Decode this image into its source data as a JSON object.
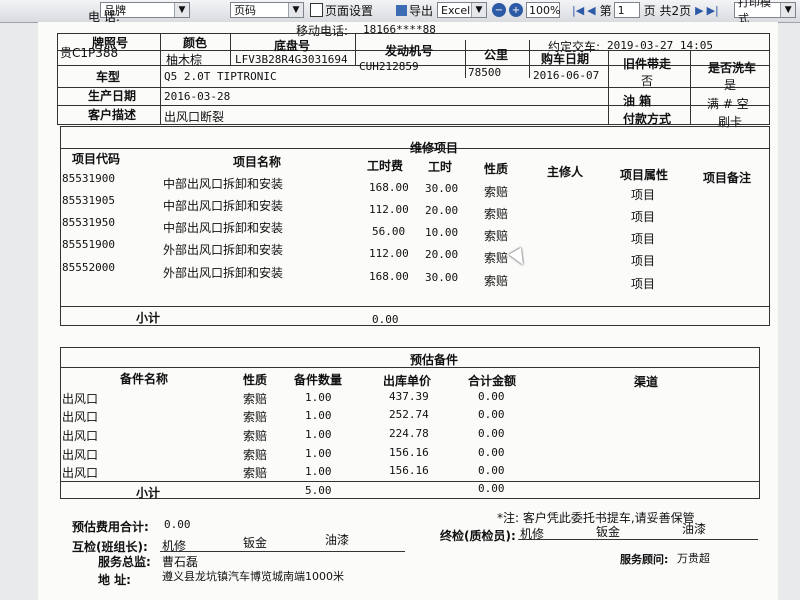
{
  "toolbar": {
    "combo1": "品牌",
    "combo2": "页码",
    "page_setup": "页面设置",
    "export": "导出",
    "export_format": "Excel",
    "zoom": "100%",
    "page_prefix": "第",
    "page_value": "1",
    "page_suffix": "页 共2页",
    "print_mode": "打印模式"
  },
  "top": {
    "phone_label": "电    话:",
    "mobile_label": "移动电话:",
    "mobile_value": "18166****88",
    "appt_label": "约定交车:",
    "appt_value": "2019-03-27 14:05"
  },
  "vehicle": {
    "plate_label": "牌照号",
    "plate": "贵C1P388",
    "color_label": "颜色",
    "color": "柚木棕",
    "chassis_label": "底盘号",
    "chassis": "LFV3B28R4G3031694",
    "engine_label": "发动机号",
    "engine": "CUH212859",
    "km_label": "公里",
    "km": "78500",
    "buy_label": "购车日期",
    "buy": "2016-06-07",
    "old_parts_label": "旧件带走",
    "old_parts": "否",
    "wash_label": "是否洗车",
    "wash": "是",
    "model_label": "车型",
    "model": "Q5 2.0T TIPTRONIC",
    "prod_label": "生产日期",
    "prod": "2016-03-28",
    "fuel_label": "油    箱",
    "fuel": "满 # 空",
    "desc_label": "客户描述",
    "desc": "出风口断裂",
    "pay_label": "付款方式",
    "pay": "刷卡"
  },
  "repair": {
    "title": "维修项目",
    "headers": [
      "项目代码",
      "项目名称",
      "工时费",
      "工时",
      "性质",
      "主修人",
      "项目属性",
      "项目备注"
    ],
    "rows": [
      [
        "85531900",
        "中部出风口拆卸和安装",
        "168.00",
        "30.00",
        "索赔",
        "",
        "项目",
        ""
      ],
      [
        "85531905",
        "中部出风口拆卸和安装",
        "112.00",
        "20.00",
        "索赔",
        "",
        "项目",
        ""
      ],
      [
        "85531950",
        "中部出风口拆卸和安装",
        "56.00",
        "10.00",
        "索赔",
        "",
        "项目",
        ""
      ],
      [
        "85551900",
        "外部出风口拆卸和安装",
        "112.00",
        "20.00",
        "索赔",
        "",
        "项目",
        ""
      ],
      [
        "85552000",
        "外部出风口拆卸和安装",
        "168.00",
        "30.00",
        "索赔",
        "",
        "项目",
        ""
      ]
    ],
    "subtotal_label": "小计",
    "subtotal": "0.00"
  },
  "parts": {
    "title": "预估备件",
    "headers": [
      "备件名称",
      "性质",
      "备件数量",
      "出库单价",
      "合计金额",
      "渠道"
    ],
    "rows": [
      [
        "出风口",
        "索赔",
        "1.00",
        "437.39",
        "0.00"
      ],
      [
        "出风口",
        "索赔",
        "1.00",
        "252.74",
        "0.00"
      ],
      [
        "出风口",
        "索赔",
        "1.00",
        "224.78",
        "0.00"
      ],
      [
        "出风口",
        "索赔",
        "1.00",
        "156.16",
        "0.00"
      ],
      [
        "出风口",
        "索赔",
        "1.00",
        "156.16",
        "0.00"
      ]
    ],
    "subtotal_label": "小计",
    "subtotal_qty": "5.00",
    "subtotal_amount": "0.00"
  },
  "footer": {
    "est_label": "预估费用合计:",
    "est_value": "0.00",
    "note": "*注: 客户凭此委托书提车,请妥善保管",
    "mutual_label": "互检(班组长):",
    "inspector_label": "终检(质检员):",
    "trades": [
      "机修",
      "钣金",
      "油漆"
    ],
    "director_label": "服务总监:",
    "director": "曹石磊",
    "advisor_label": "服务顾问:",
    "advisor": "万贵超",
    "address_label": "地    址:",
    "address": "遵义县龙坑镇汽车博览城南端1000米"
  }
}
